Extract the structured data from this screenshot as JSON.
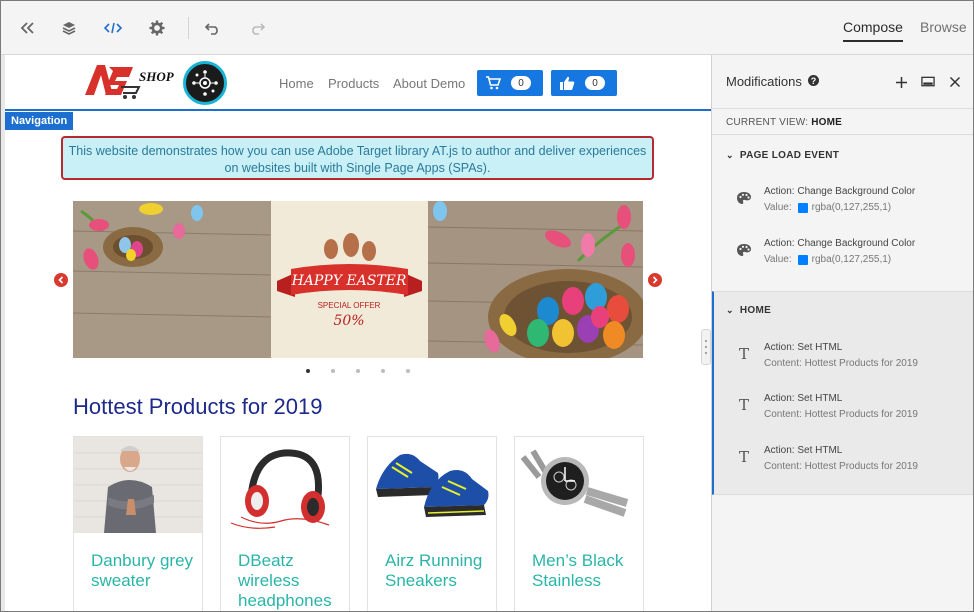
{
  "toolbar": {
    "tabs": [
      {
        "label": "Compose",
        "active": true
      },
      {
        "label": "Browse",
        "active": false
      }
    ],
    "icons": [
      "collapse-icon",
      "layers-icon",
      "code-icon",
      "gear-icon",
      "undo-icon",
      "redo-icon"
    ]
  },
  "site": {
    "logo_text": "SHOP",
    "nav": [
      "Home",
      "Products",
      "About Demo"
    ],
    "cart_count": "0",
    "like_count": "0",
    "navigation_tag": "Navigation",
    "notice": "This website demonstrates how you can use Adobe Target library AT.js to author and deliver experiences on websites built with Single Page Apps (SPAs).",
    "banner": {
      "line1": "HAPPY EASTER",
      "line2": "SPECIAL OFFER",
      "line3": "50%"
    },
    "carousel_dots": 5,
    "carousel_active_dot": 0,
    "section_title": "Hottest Products for 2019",
    "products": [
      {
        "name": "Danbury grey sweater"
      },
      {
        "name": "DBeatz wireless headphones"
      },
      {
        "name": "Airz Running Sneakers"
      },
      {
        "name": "Men’s Black Stainless"
      }
    ]
  },
  "panel": {
    "title": "Modifications",
    "help": "?",
    "current_view_label": "CURRENT VIEW:",
    "current_view_value": "HOME",
    "sections": [
      {
        "name": "PAGE LOAD EVENT",
        "items": [
          {
            "action": "Action: Change Background Color",
            "detail_label": "Value:",
            "detail_value": "rgba(0,127,255,1)"
          },
          {
            "action": "Action: Change Background Color",
            "detail_label": "Value:",
            "detail_value": "rgba(0,127,255,1)"
          }
        ]
      },
      {
        "name": "HOME",
        "items": [
          {
            "action": "Action: Set HTML",
            "detail": "Content: Hottest Products for 2019"
          },
          {
            "action": "Action: Set HTML",
            "detail": "Content: Hottest Products for 2019"
          },
          {
            "action": "Action: Set HTML",
            "detail": "Content: Hottest Products for 2019"
          }
        ]
      }
    ]
  },
  "colors": {
    "accent": "#1c6fce",
    "brand_red": "#d83a2f",
    "product_text": "#2ab5a8",
    "title_blue": "#1d2a8a",
    "swatch": "#007fff"
  }
}
